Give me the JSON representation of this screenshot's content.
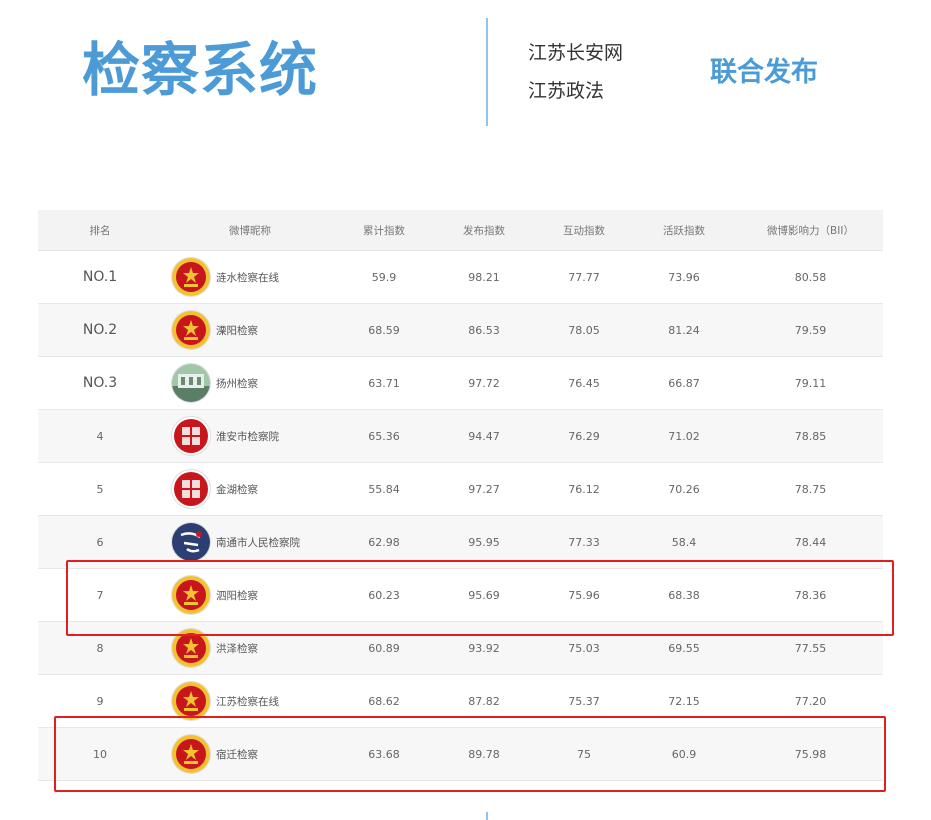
{
  "header": {
    "title": "检察系统",
    "sources": [
      "江苏长安网",
      "江苏政法"
    ],
    "joint_label": "联合发布"
  },
  "table": {
    "columns": [
      "排名",
      "微博昵称",
      "累计指数",
      "发布指数",
      "互动指数",
      "活跃指数",
      "微博影响力（BII）"
    ],
    "rows": [
      {
        "rank": "NO.1",
        "name": "涟水检察在线",
        "total": "59.9",
        "publish": "98.21",
        "interact": "77.77",
        "active": "73.96",
        "bii": "80.58",
        "avatar": "national-emblem-icon"
      },
      {
        "rank": "NO.2",
        "name": "溧阳检察",
        "total": "68.59",
        "publish": "86.53",
        "interact": "78.05",
        "active": "81.24",
        "bii": "79.59",
        "avatar": "national-emblem-icon"
      },
      {
        "rank": "NO.3",
        "name": "扬州检察",
        "total": "63.71",
        "publish": "97.72",
        "interact": "76.45",
        "active": "66.87",
        "bii": "79.11",
        "avatar": "building-photo-icon"
      },
      {
        "rank": "4",
        "name": "淮安市检察院",
        "total": "65.36",
        "publish": "94.47",
        "interact": "76.29",
        "active": "71.02",
        "bii": "78.85",
        "avatar": "red-seal-icon"
      },
      {
        "rank": "5",
        "name": "金湖检察",
        "total": "55.84",
        "publish": "97.27",
        "interact": "76.12",
        "active": "70.26",
        "bii": "78.75",
        "avatar": "red-seal-icon"
      },
      {
        "rank": "6",
        "name": "南通市人民检察院",
        "total": "62.98",
        "publish": "95.95",
        "interact": "77.33",
        "active": "58.4",
        "bii": "78.44",
        "avatar": "calligraphy-icon"
      },
      {
        "rank": "7",
        "name": "泗阳检察",
        "total": "60.23",
        "publish": "95.69",
        "interact": "75.96",
        "active": "68.38",
        "bii": "78.36",
        "avatar": "national-emblem-icon"
      },
      {
        "rank": "8",
        "name": "洪泽检察",
        "total": "60.89",
        "publish": "93.92",
        "interact": "75.03",
        "active": "69.55",
        "bii": "77.55",
        "avatar": "national-emblem-icon"
      },
      {
        "rank": "9",
        "name": "江苏检察在线",
        "total": "68.62",
        "publish": "87.82",
        "interact": "75.37",
        "active": "72.15",
        "bii": "77.20",
        "avatar": "national-emblem-icon"
      },
      {
        "rank": "10",
        "name": "宿迁检察",
        "total": "63.68",
        "publish": "89.78",
        "interact": "75",
        "active": "60.9",
        "bii": "75.98",
        "avatar": "national-emblem-icon"
      }
    ]
  },
  "colors": {
    "accent_blue": "#4c9bd6",
    "highlight_red": "#e0201f",
    "emblem_red": "#c8161d",
    "emblem_gold": "#f2c230"
  }
}
